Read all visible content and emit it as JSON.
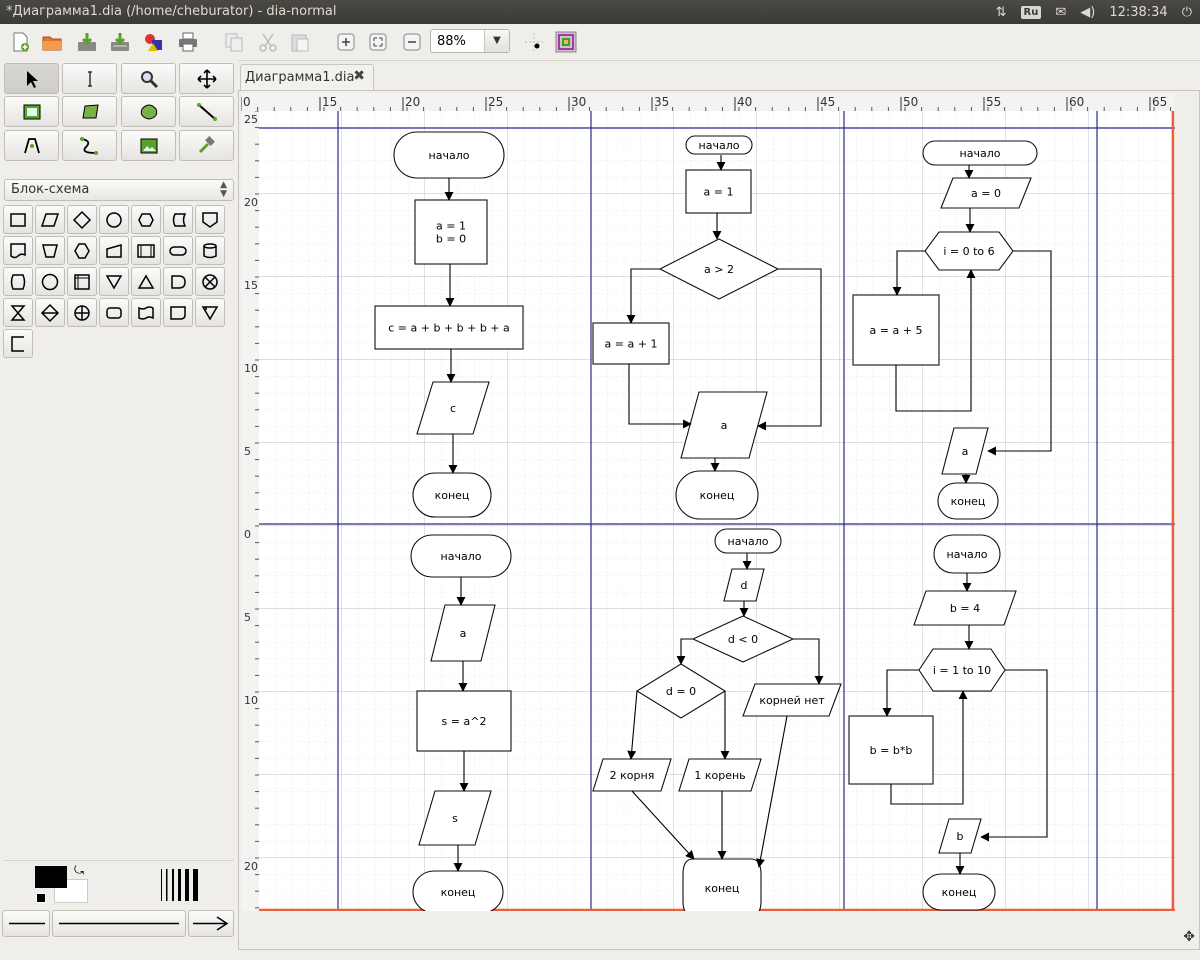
{
  "window": {
    "title": "*Диаграмма1.dia (/home/cheburator) - dia-normal"
  },
  "tray": {
    "keyboard_layout": "Ru",
    "time": "12:38:34"
  },
  "toolbar": {
    "zoom_value": "88%"
  },
  "toolbox": {
    "sheet": "Блок-схема"
  },
  "document": {
    "tab_label": "Диаграмма1.dia"
  },
  "ruler": {
    "horizontal_labels": [
      "0",
      "15",
      "20",
      "25",
      "30",
      "35",
      "40",
      "45",
      "50",
      "55",
      "60",
      "65"
    ],
    "vertical_labels": [
      "25",
      "20",
      "15",
      "10",
      "5",
      "0",
      "5",
      "10",
      "20"
    ]
  },
  "colors": {
    "foreground": "#000000",
    "background": "#ffffff",
    "page_border": "#e8603c",
    "grid": "#b8c8d4",
    "page_lines": "#2b2b8a"
  },
  "diagram": {
    "flow1": {
      "start": "начало",
      "assign": [
        "a = 1",
        "b = 0"
      ],
      "process": "c = a + b + b + b + a",
      "output": "c",
      "end": "конец"
    },
    "flow2": {
      "start": "начало",
      "assign": "a = 1",
      "condition": "a > 2",
      "process": "a  = a + 1",
      "output": "a",
      "end": "конец"
    },
    "flow3": {
      "start": "начало",
      "input": "a = 0",
      "loop": "i = 0 to 6",
      "process": "a = a + 5",
      "output": "a",
      "end": "конец"
    },
    "flow4": {
      "start": "начало",
      "input": "a",
      "process": "s = a^2",
      "output": "s",
      "end": "конец"
    },
    "flow5": {
      "start": "начало",
      "input": "d",
      "condition1": "d < 0",
      "condition2": "d = 0",
      "out_two": "2 корня",
      "out_one": "1 корень",
      "out_none": "корней нет",
      "end": "конец"
    },
    "flow6": {
      "start": "начало",
      "input": "b = 4",
      "loop": "i = 1 to 10",
      "process": "b = b*b",
      "output": "b",
      "end": "конец"
    }
  }
}
